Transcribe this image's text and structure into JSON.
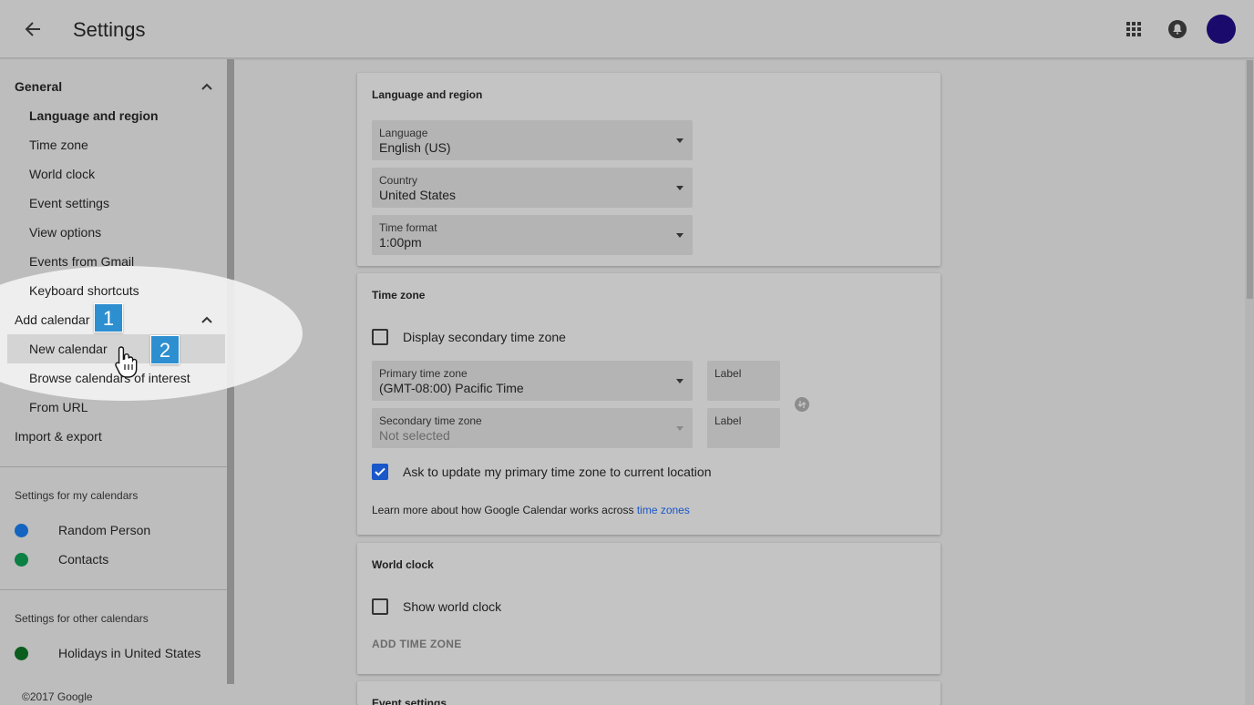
{
  "header": {
    "title": "Settings",
    "back_icon": "arrow-left-icon",
    "apps_icon": "apps-grid-icon",
    "notifications_icon": "bell-icon",
    "avatar_color": "#1a0a6b"
  },
  "sidebar": {
    "general_label": "General",
    "general_items": [
      "Language and region",
      "Time zone",
      "World clock",
      "Event settings",
      "View options",
      "Events from Gmail",
      "Keyboard shortcuts"
    ],
    "add_calendar_label": "Add calendar",
    "add_calendar_items": [
      "New calendar",
      "Browse calendars of interest",
      "From URL"
    ],
    "import_export_label": "Import & export",
    "my_calendars_label": "Settings for my calendars",
    "my_calendars": [
      {
        "name": "Random Person",
        "color": "#1565c0"
      },
      {
        "name": "Contacts",
        "color": "#0b8043"
      }
    ],
    "other_calendars_label": "Settings for other calendars",
    "other_calendars": [
      {
        "name": "Holidays in United States",
        "color": "#0b5d1e"
      }
    ],
    "copyright": "©2017 Google"
  },
  "annotations": {
    "step1": "1",
    "step2": "2",
    "badge_color": "#2d8fd0"
  },
  "language_region": {
    "title": "Language and region",
    "language": {
      "label": "Language",
      "value": "English (US)"
    },
    "country": {
      "label": "Country",
      "value": "United States"
    },
    "time_format": {
      "label": "Time format",
      "value": "1:00pm"
    }
  },
  "time_zone": {
    "title": "Time zone",
    "secondary_checkbox_label": "Display secondary time zone",
    "secondary_checked": false,
    "primary": {
      "label": "Primary time zone",
      "value": "(GMT-08:00) Pacific Time"
    },
    "primary_label_box": "Label",
    "secondary": {
      "label": "Secondary time zone",
      "value": "Not selected"
    },
    "secondary_label_box": "Label",
    "ask_update_label": "Ask to update my primary time zone to current location",
    "ask_update_checked": true,
    "learn_more_text": "Learn more about how Google Calendar works across ",
    "learn_more_link": "time zones",
    "link_color": "#1a57c8"
  },
  "world_clock": {
    "title": "World clock",
    "show_label": "Show world clock",
    "show_checked": false,
    "add_button": "ADD TIME ZONE"
  },
  "event_settings": {
    "title": "Event settings"
  }
}
